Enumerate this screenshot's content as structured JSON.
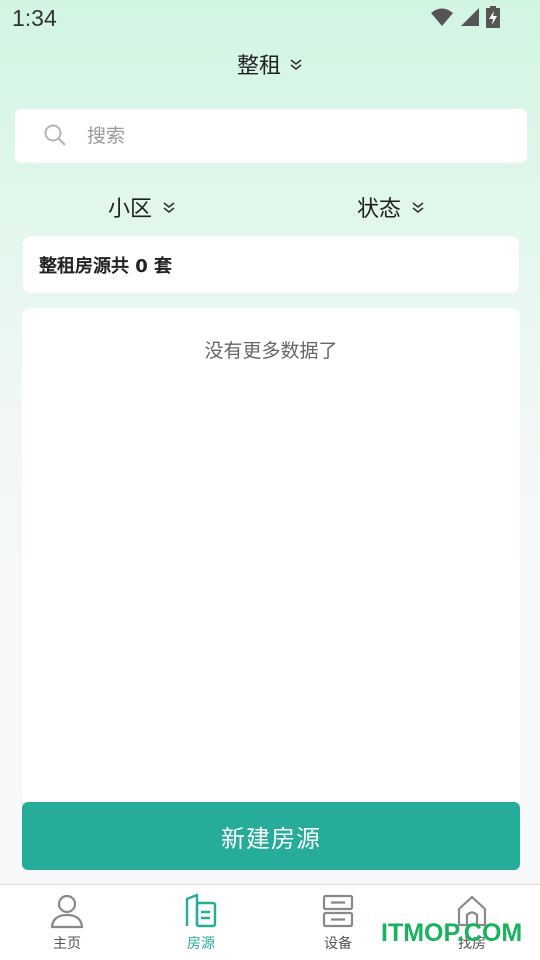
{
  "status_bar": {
    "time": "1:34"
  },
  "header": {
    "title": "整租"
  },
  "search": {
    "placeholder": "搜索",
    "value": ""
  },
  "filters": {
    "community_label": "小区",
    "status_label": "状态"
  },
  "summary": {
    "text": "整租房源共 0 套"
  },
  "list": {
    "empty_text": "没有更多数据了"
  },
  "actions": {
    "create_label": "新建房源"
  },
  "tabbar": {
    "items": [
      {
        "label": "主页",
        "icon": "person-icon",
        "active": false
      },
      {
        "label": "房源",
        "icon": "building-icon",
        "active": true
      },
      {
        "label": "设备",
        "icon": "device-icon",
        "active": false
      },
      {
        "label": "找房",
        "icon": "house-icon",
        "active": false
      }
    ]
  },
  "watermark": {
    "text": "ITMOP.COM"
  },
  "colors": {
    "accent": "#25ad9a",
    "watermark": "#18b35c"
  }
}
